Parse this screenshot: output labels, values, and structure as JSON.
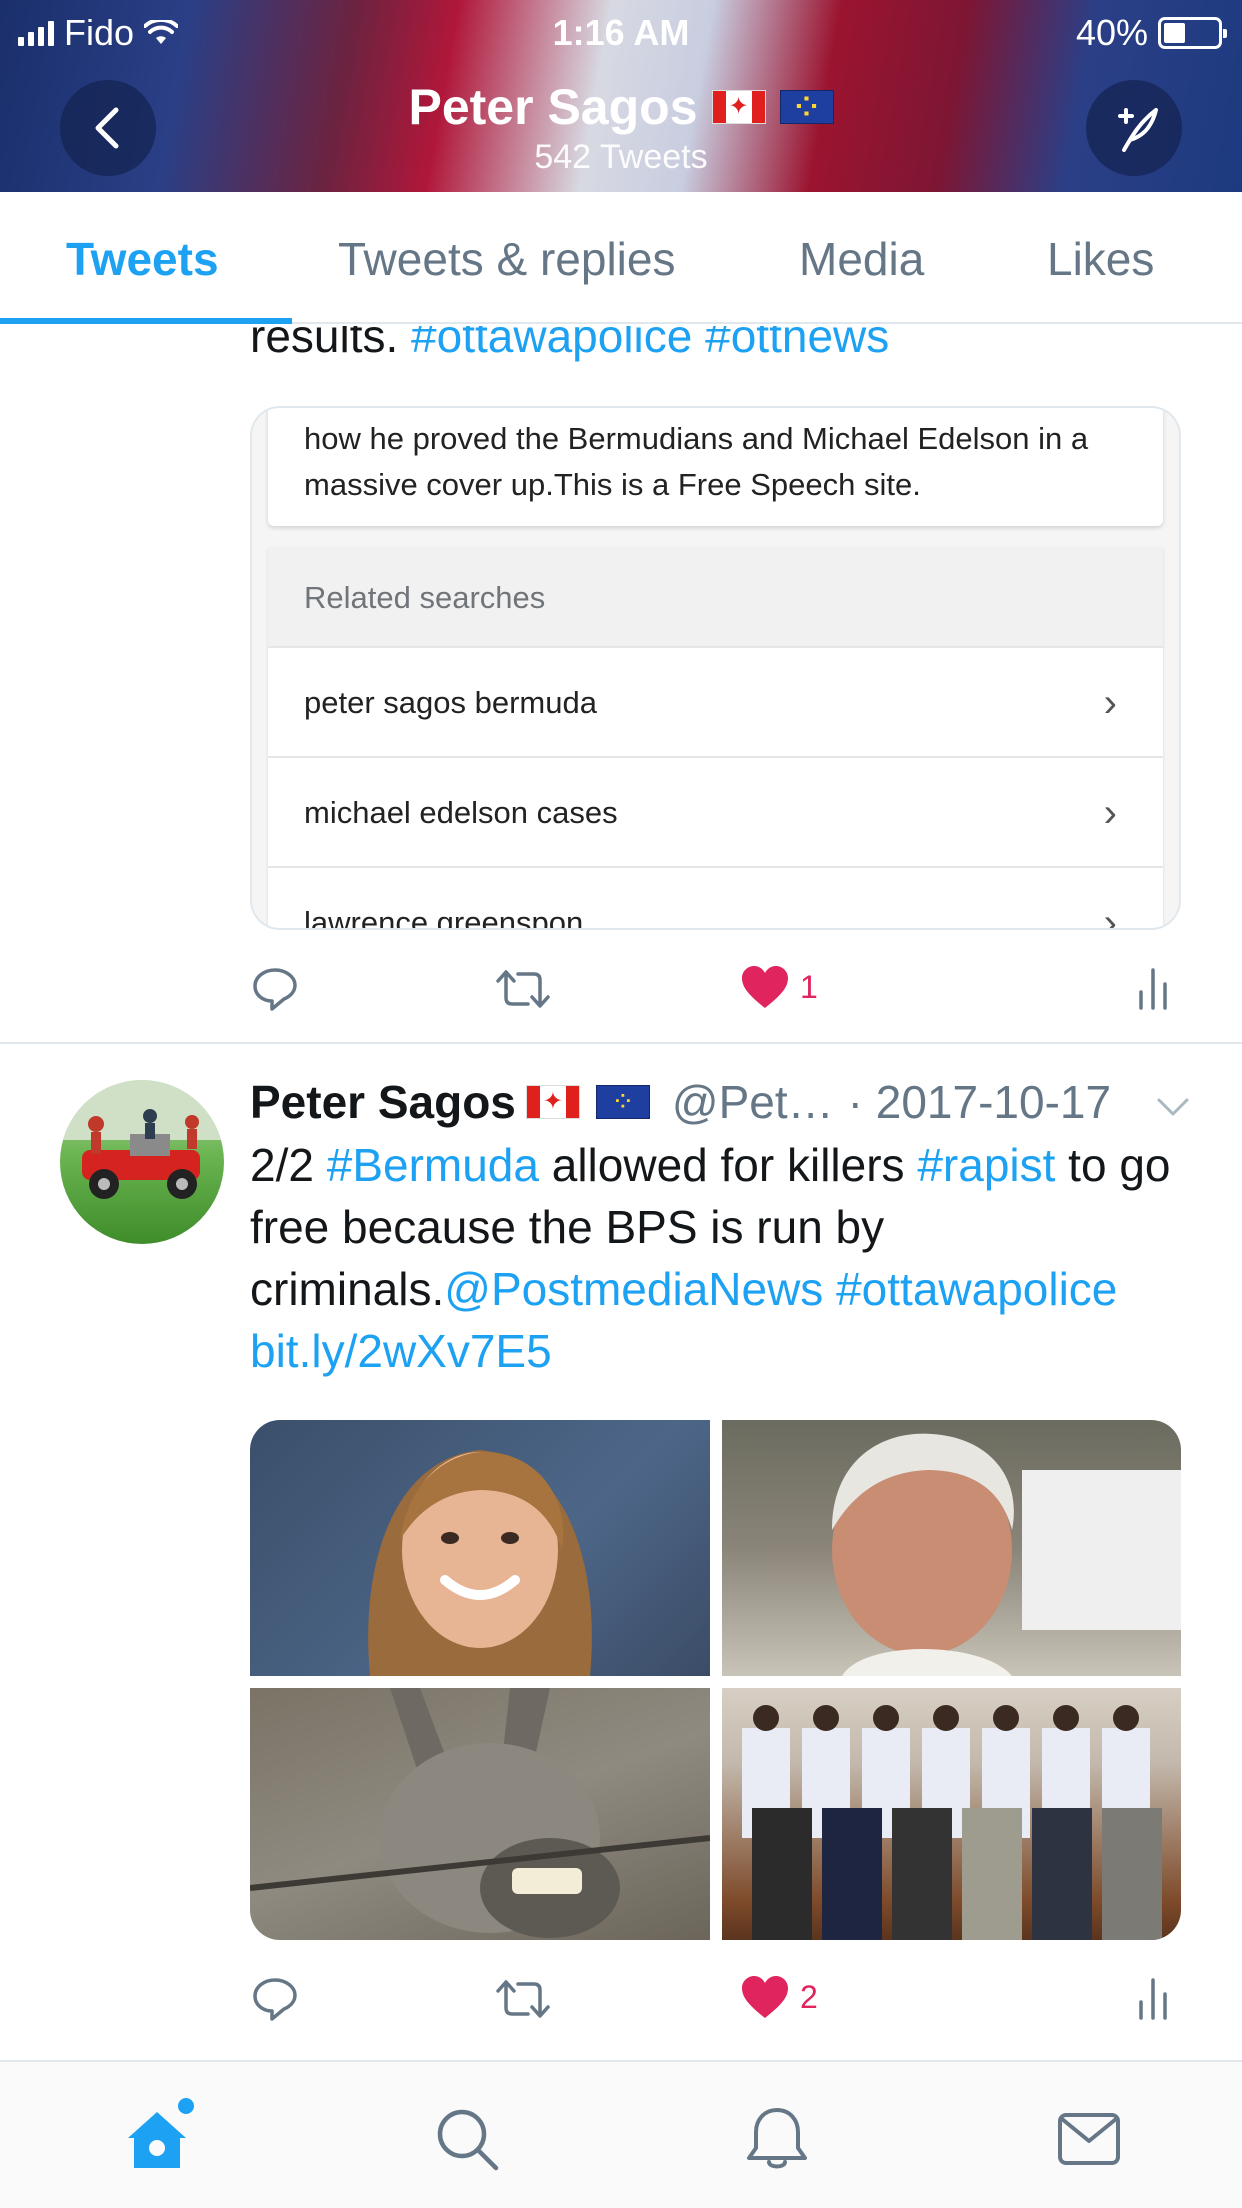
{
  "status_bar": {
    "carrier": "Fido",
    "time": "1:16 AM",
    "battery": "40%",
    "battery_level": 0.4
  },
  "header": {
    "name": "Peter Sagos",
    "tweet_count": "542 Tweets",
    "flags": [
      "canada-flag",
      "eu-flag"
    ]
  },
  "tabs": [
    {
      "label": "Tweets",
      "active": true
    },
    {
      "label": "Tweets & replies",
      "active": false
    },
    {
      "label": "Media",
      "active": false
    },
    {
      "label": "Likes",
      "active": false
    }
  ],
  "tweet1": {
    "text_plain": "results. ",
    "hashtags": [
      "#ottawapolice",
      "#ottnews"
    ],
    "card": {
      "snippet": "how he proved the Bermudians and Michael Edelson in a massive cover up.This is a Free Speech site.",
      "related_title": "Related searches",
      "related_items": [
        "peter sagos bermuda",
        "michael edelson cases",
        "lawrence greenspon"
      ]
    },
    "likes": "1"
  },
  "tweet2": {
    "name": "Peter Sagos",
    "handle": "@Pet…",
    "date": "· 2017-10-17",
    "text": {
      "p1": "2/2 ",
      "l1": "#Bermuda",
      "p2": " allowed for killers ",
      "l2": "#rapist",
      "p3": " to go free because the BPS is run by criminals.",
      "l3": "@PostmediaNews",
      "l4": "#ottawapolice",
      "l5": "bit.ly/2wXv7E5"
    },
    "likes": "2"
  },
  "colors": {
    "accent": "#1da1f2",
    "like": "#e0245e",
    "icon_gray": "#657786"
  },
  "bottom_nav": [
    "home-icon",
    "search-icon",
    "notifications-icon",
    "messages-icon"
  ]
}
